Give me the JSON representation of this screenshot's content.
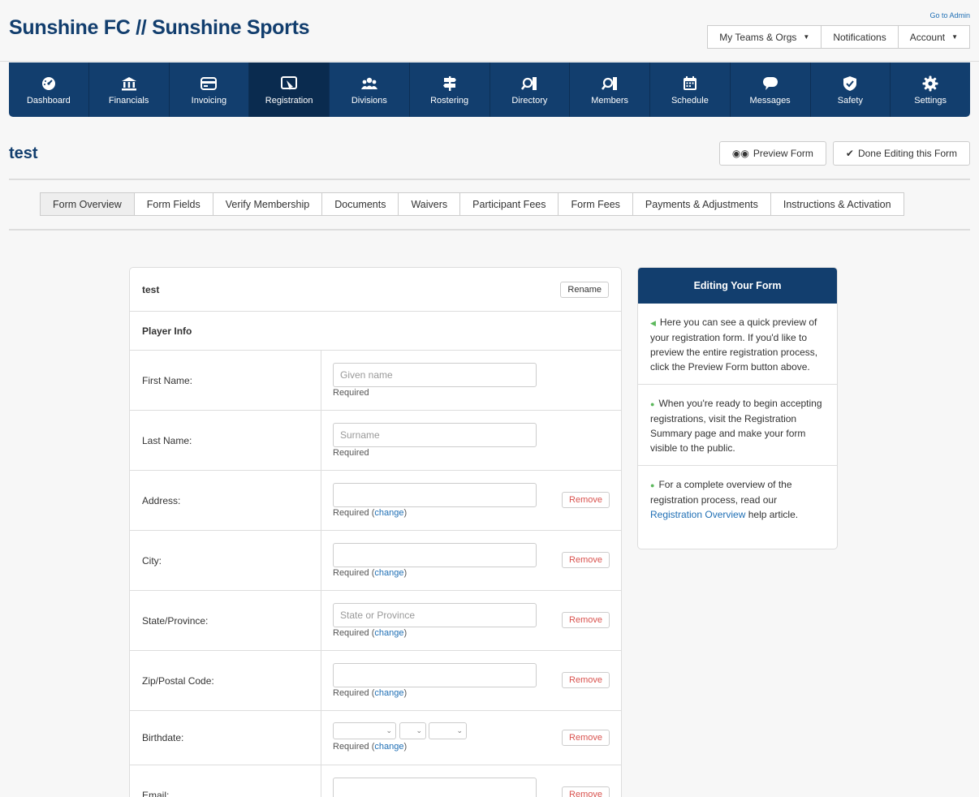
{
  "header": {
    "go_admin": "Go to Admin",
    "brand": "Sunshine FC // Sunshine Sports",
    "my_teams": "My Teams & Orgs",
    "notifications": "Notifications",
    "account": "Account"
  },
  "nav": [
    {
      "label": "Dashboard",
      "icon": "dashboard-icon"
    },
    {
      "label": "Financials",
      "icon": "bank-icon"
    },
    {
      "label": "Invoicing",
      "icon": "credit-card-icon"
    },
    {
      "label": "Registration",
      "icon": "registration-icon",
      "active": true
    },
    {
      "label": "Divisions",
      "icon": "users-icon"
    },
    {
      "label": "Rostering",
      "icon": "signpost-icon"
    },
    {
      "label": "Directory",
      "icon": "directory-icon"
    },
    {
      "label": "Members",
      "icon": "members-icon"
    },
    {
      "label": "Schedule",
      "icon": "calendar-icon"
    },
    {
      "label": "Messages",
      "icon": "chat-icon"
    },
    {
      "label": "Safety",
      "icon": "shield-icon"
    },
    {
      "label": "Settings",
      "icon": "gear-icon"
    }
  ],
  "page": {
    "title": "test",
    "preview_button": "Preview Form",
    "done_button": "Done Editing this Form"
  },
  "tabs": [
    "Form Overview",
    "Form Fields",
    "Verify Membership",
    "Documents",
    "Waivers",
    "Participant Fees",
    "Form Fees",
    "Payments & Adjustments",
    "Instructions & Activation"
  ],
  "form": {
    "name": "test",
    "rename": "Rename",
    "section": "Player Info",
    "remove_label": "Remove",
    "change_label": "change",
    "fields": {
      "first_name": {
        "label": "First Name:",
        "placeholder": "Given name",
        "req": "Required"
      },
      "last_name": {
        "label": "Last Name:",
        "placeholder": "Surname",
        "req": "Required"
      },
      "address": {
        "label": "Address:",
        "placeholder": "",
        "req": "Required"
      },
      "city": {
        "label": "City:",
        "placeholder": "",
        "req": "Required"
      },
      "state": {
        "label": "State/Province:",
        "placeholder": "State or Province",
        "req": "Required"
      },
      "zip": {
        "label": "Zip/Postal Code:",
        "placeholder": "",
        "req": "Required"
      },
      "birthdate": {
        "label": "Birthdate:",
        "req": "Required"
      },
      "email": {
        "label": "Email:",
        "placeholder": ""
      }
    }
  },
  "sidebar": {
    "title": "Editing Your Form",
    "sec1": "Here you can see a quick preview of your registration form. If you'd like to preview the entire registration process, click the Preview Form button above.",
    "sec2": "When you're ready to begin accepting registrations, visit the Registration Summary page and make your form visible to the public.",
    "sec3_pre": "For a complete overview of the registration process, read our",
    "sec3_link": "Registration Overview",
    "sec3_post": "help article."
  },
  "colors": {
    "brand_navy": "#123e6e",
    "remove_red": "#d9534f",
    "link_blue": "#1f6fb5",
    "bullet_green": "#5cb85c"
  }
}
